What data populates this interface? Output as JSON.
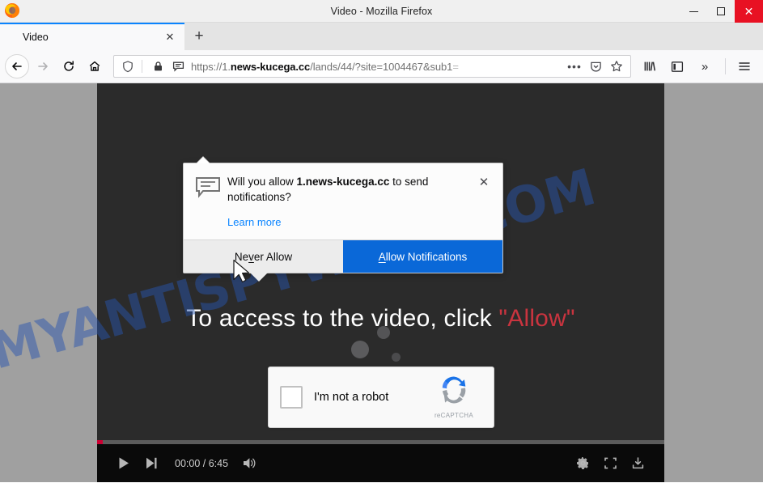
{
  "window": {
    "title": "Video - Mozilla Firefox",
    "controls": {
      "minimize": "—",
      "maximize": "☐",
      "close": "✕"
    }
  },
  "tabs": {
    "active": {
      "label": "Video",
      "close": "✕"
    },
    "new_tab": "+"
  },
  "navbar": {
    "back": "back-arrow",
    "forward": "forward-arrow",
    "reload": "reload",
    "home": "home",
    "url": {
      "scheme": "https://1.",
      "domain": "news-kucega.cc",
      "path": "/lands/44/?site=1004467&sub1",
      "truncated_tail": "=",
      "full": "https://1.news-kucega.cc/lands/44/?site=1004467&sub1="
    },
    "page_actions": "•••",
    "pocket": "pocket-icon",
    "bookmark": "star-icon",
    "library": "library-icon",
    "sidebar": "sidebar-icon",
    "overflow": "»",
    "menu": "hamburger-icon"
  },
  "doorhanger": {
    "question_prefix": "Will you allow ",
    "origin": "1.news-kucega.cc",
    "question_suffix": " to send notifications?",
    "learn_more": "Learn more",
    "close": "✕",
    "never_allow": {
      "pre": "Ne",
      "accel": "v",
      "post": "er Allow"
    },
    "allow_notifications": {
      "accel": "A",
      "post": "llow Notifications"
    },
    "primary_color": "#0a68d8",
    "secondary_color": "#ececec"
  },
  "page": {
    "headline_text": "To access to the video, click ",
    "headline_highlight": "\"Allow\"",
    "headline_highlight_color": "#c9343f",
    "watermark": "MYANTISPYWARE.COM",
    "watermark_color": "#2855af",
    "recaptcha": {
      "label": "I'm not a robot",
      "brand": "reCAPTCHA"
    }
  },
  "player": {
    "play": "play-icon",
    "next": "next-icon",
    "time": "00:00 / 6:45",
    "volume": "volume-icon",
    "settings": "gear-icon",
    "fullscreen": "fullscreen-icon",
    "download": "download-icon",
    "progress_percent": 1
  }
}
